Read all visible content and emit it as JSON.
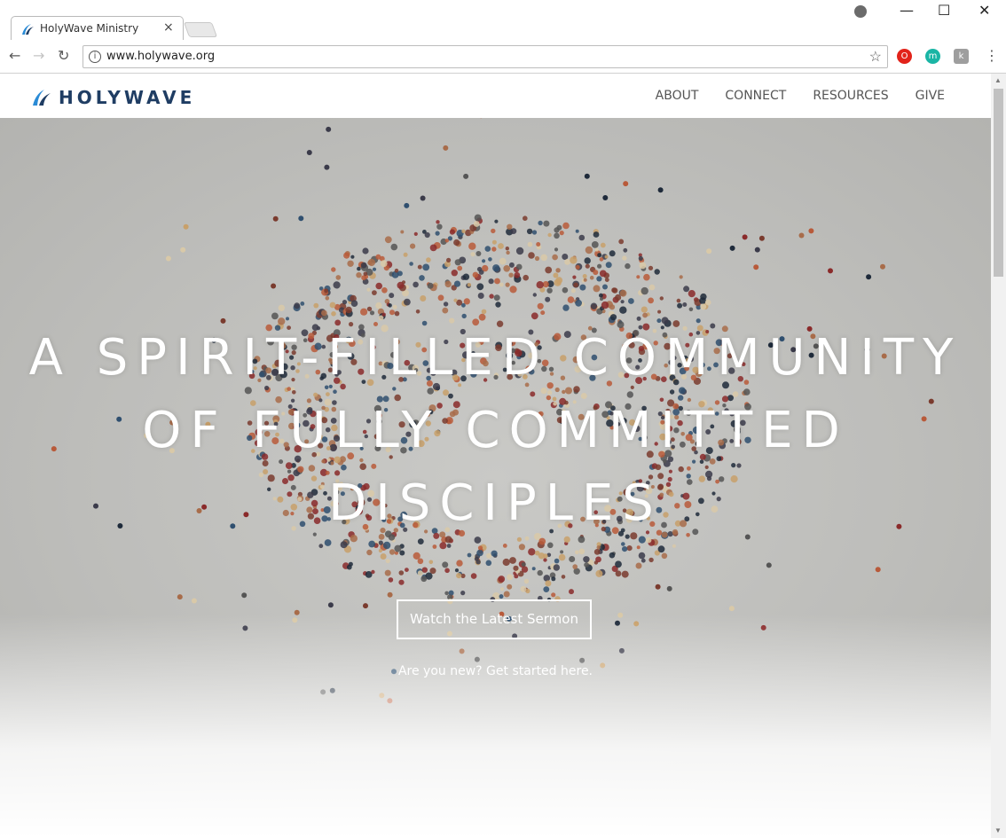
{
  "browser": {
    "tab_title": "HolyWave Ministry",
    "tab_close": "×",
    "url": "www.holywave.org",
    "controls": {
      "minimize": "—",
      "maximize": "☐",
      "close": "✕"
    },
    "nav": {
      "back": "←",
      "forward": "→",
      "reload": "↻"
    },
    "info": "i",
    "star": "☆",
    "extensions": [
      {
        "name": "opera-icon",
        "color": "#e2231a",
        "glyph": "O"
      },
      {
        "name": "m-extension-icon",
        "color": "#1ab5a5",
        "glyph": "m"
      },
      {
        "name": "k-extension-icon",
        "color": "#9e9e9e",
        "glyph": "k"
      }
    ],
    "menu": "⋮"
  },
  "site": {
    "logo_text": "HOLYWAVE",
    "nav": [
      "ABOUT",
      "CONNECT",
      "RESOURCES",
      "GIVE"
    ],
    "hero": {
      "title_line1": "A SPIRIT-FILLED COMMUNITY",
      "title_line2": "OF FULLY COMMITTED",
      "title_line3": "DISCIPLES",
      "cta": "Watch the Latest Sermon",
      "sublink": "Are you new? Get started here."
    }
  },
  "colors": {
    "brand": "#1f3d63",
    "accent": "#2a8bd6"
  }
}
